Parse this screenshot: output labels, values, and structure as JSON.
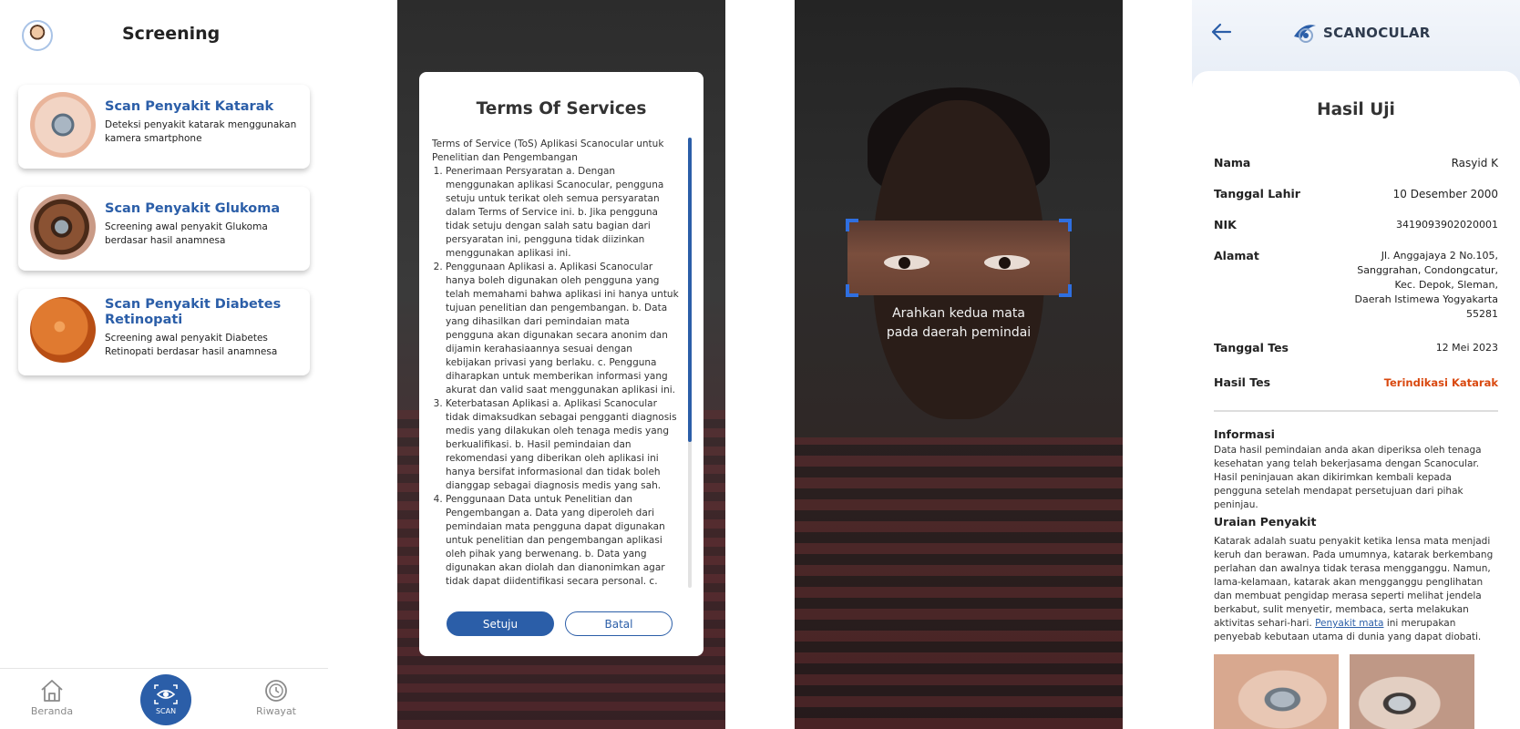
{
  "screening": {
    "title": "Screening",
    "cards": [
      {
        "title": "Scan Penyakit Katarak",
        "desc": "Deteksi penyakit katarak menggunakan kamera smartphone"
      },
      {
        "title": "Scan Penyakit Glukoma",
        "desc": "Screening awal penyakit Glukoma berdasar hasil anamnesa"
      },
      {
        "title": "Scan Penyakit Diabetes Retinopati",
        "desc": "Screening awal penyakit Diabetes Retinopati berdasar hasil anamnesa"
      }
    ],
    "nav": {
      "home": "Beranda",
      "scan": "SCAN",
      "history": "Riwayat"
    }
  },
  "tos": {
    "title": "Terms Of Services",
    "intro": "Terms of Service (ToS) Aplikasi Scanocular untuk Penelitian dan Pengembangan",
    "items": [
      "Penerimaan Persyaratan a. Dengan menggunakan aplikasi Scanocular, pengguna setuju untuk terikat oleh semua persyaratan dalam Terms of Service ini. b. Jika pengguna tidak setuju dengan salah satu bagian dari persyaratan ini, pengguna tidak diizinkan menggunakan aplikasi ini.",
      "Penggunaan Aplikasi a. Aplikasi Scanocular hanya boleh digunakan oleh pengguna yang telah memahami bahwa aplikasi ini hanya untuk tujuan penelitian dan pengembangan. b. Data yang dihasilkan dari pemindaian mata pengguna akan digunakan secara anonim dan dijamin kerahasiaannya sesuai dengan kebijakan privasi yang berlaku. c. Pengguna diharapkan untuk memberikan informasi yang akurat dan valid saat menggunakan aplikasi ini.",
      "Keterbatasan Aplikasi a. Aplikasi Scanocular tidak dimaksudkan sebagai pengganti diagnosis medis yang dilakukan oleh tenaga medis yang berkualifikasi. b. Hasil pemindaian dan rekomendasi yang diberikan oleh aplikasi ini hanya bersifat informasional dan tidak boleh dianggap sebagai diagnosis medis yang sah.",
      "Penggunaan Data untuk Penelitian dan Pengembangan a. Data yang diperoleh dari pemindaian mata pengguna dapat digunakan untuk penelitian dan pengembangan aplikasi oleh pihak yang berwenang. b. Data yang digunakan akan diolah dan dianonimkan agar tidak dapat diidentifikasi secara personal. c. Pihak yang berwenang akan menjaga kerahasiaan dan"
    ],
    "agree_label": "Setuju",
    "cancel_label": "Batal"
  },
  "scanner": {
    "caption_line1": "Arahkan kedua mata",
    "caption_line2": "pada daerah pemindai"
  },
  "result": {
    "brand": "SCANOCULAR",
    "title": "Hasil Uji",
    "rows": [
      {
        "label": "Nama",
        "value": "Rasyid K"
      },
      {
        "label": "Tanggal Lahir",
        "value": "10 Desember 2000"
      },
      {
        "label": "NIK",
        "value": "3419093902020001"
      },
      {
        "label": "Alamat",
        "lines": [
          "Jl. Anggajaya 2 No.105,",
          "Sanggrahan, Condongcatur,",
          "Kec. Depok,  Sleman,",
          "Daerah Istimewa Yogyakarta",
          "55281"
        ]
      },
      {
        "label": "Tanggal Tes",
        "value": "12 Mei 2023"
      },
      {
        "label": "Hasil Tes",
        "value": "Terindikasi Katarak"
      }
    ],
    "info_title": "Informasi",
    "info_text": "Data hasil pemindaian anda akan diperiksa oleh tenaga kesehatan yang telah bekerjasama dengan Scanocular. Hasil peninjauan akan dikirimkan kembali kepada pengguna setelah mendapat persetujuan dari pihak peninjau.",
    "disease_title": "Uraian Penyakit",
    "disease_text": "Katarak adalah suatu penyakit ketika lensa mata menjadi keruh dan berawan. Pada umumnya, katarak berkembang perlahan dan awalnya tidak terasa mengganggu. Namun, lama-kelamaan, katarak akan mengganggu penglihatan dan  membuat pengidap merasa seperti melihat jendela berkabut, sulit menyetir, membaca, serta melakukan aktivitas sehari-hari.",
    "disease_link": "Penyakit mata",
    "disease_tail": " ini merupakan penyebab kebutaan utama di dunia yang dapat diobati."
  },
  "colors": {
    "accent": "#2b5ea8",
    "alert": "#d9480f"
  }
}
